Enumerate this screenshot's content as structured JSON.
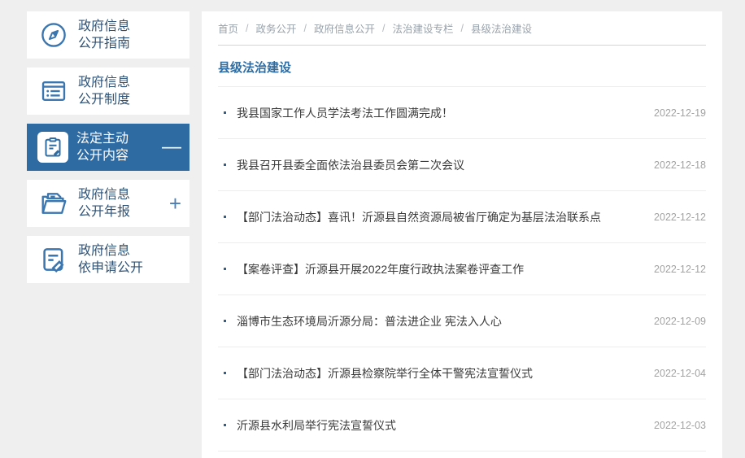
{
  "page": {
    "background": "#efefef",
    "accent_blue": "#2e6da4",
    "active_item_bg": "#2f6ba3"
  },
  "sidebar": {
    "items": [
      {
        "lines": [
          "政府信息",
          "公开指南"
        ],
        "icon": "compass-icon",
        "active": false,
        "toggle": "",
        "toggle_type": ""
      },
      {
        "lines": [
          "政府信息",
          "公开制度"
        ],
        "icon": "document-list-icon",
        "active": false,
        "toggle": "",
        "toggle_type": ""
      },
      {
        "lines": [
          "法定主动",
          "公开内容"
        ],
        "icon": "clipboard-pencil-icon",
        "active": true,
        "toggle": "—",
        "toggle_type": "minus"
      },
      {
        "lines": [
          "政府信息",
          "公开年报"
        ],
        "icon": "folder-icon",
        "active": false,
        "toggle": "+",
        "toggle_type": "plus"
      },
      {
        "lines": [
          "政府信息",
          "依申请公开"
        ],
        "icon": "document-pencil-icon",
        "active": false,
        "toggle": "",
        "toggle_type": ""
      }
    ]
  },
  "main": {
    "breadcrumb": {
      "separator": "/",
      "items": [
        "首页",
        "政务公开",
        "政府信息公开",
        "法治建设专栏",
        "县级法治建设"
      ]
    },
    "section_title": "县级法治建设",
    "articles": [
      {
        "title": "我县国家工作人员学法考法工作圆满完成！",
        "date": "2022-12-19"
      },
      {
        "title": "我县召开县委全面依法治县委员会第二次会议",
        "date": "2022-12-18"
      },
      {
        "title": "【部门法治动态】喜讯！沂源县自然资源局被省厅确定为基层法治联系点",
        "date": "2022-12-12"
      },
      {
        "title": "【案卷评查】沂源县开展2022年度行政执法案卷评查工作",
        "date": "2022-12-12"
      },
      {
        "title": "淄博市生态环境局沂源分局：普法进企业 宪法入人心",
        "date": "2022-12-09"
      },
      {
        "title": "【部门法治动态】沂源县检察院举行全体干警宪法宣誓仪式",
        "date": "2022-12-04"
      },
      {
        "title": "沂源县水利局举行宪法宣誓仪式",
        "date": "2022-12-03"
      }
    ]
  }
}
